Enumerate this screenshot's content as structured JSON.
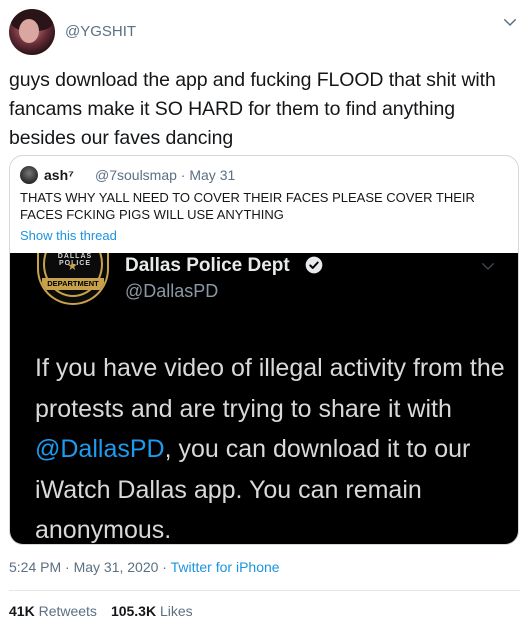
{
  "header": {
    "handle": "@YGSHIT"
  },
  "tweet": {
    "text": "guys download the app and fucking FLOOD that shit with fancams make it SO HARD for them to find anything besides our faves dancing"
  },
  "quote": {
    "name": "ash⁷",
    "handle_date": "@7soulsmap · May 31",
    "text": "THATS WHY YALL NEED TO COVER THEIR FACES PLEASE COVER THEIR FACES FCKING PIGS WILL USE ANYTHING",
    "show_thread": "Show this thread"
  },
  "embedded": {
    "badge_arc": "DALLAS POLICE",
    "badge_dept": "DEPARTMENT",
    "name": "Dallas Police Dept",
    "handle": "@DallasPD",
    "text_before": "If you have video of illegal activity from the protests and are trying to share it with ",
    "mention": "@DallasPD",
    "text_after": ", you can download it to our iWatch Dallas app. You can remain anonymous."
  },
  "meta": {
    "time_date": "5:24 PM · May 31, 2020 · ",
    "source": "Twitter for iPhone"
  },
  "stats": {
    "retweets_count": "41K",
    "retweets_label": "Retweets",
    "likes_count": "105.3K",
    "likes_label": "Likes"
  },
  "colors": {
    "link": "#1b95e0",
    "muted": "#5b7083",
    "badge_gold": "#c8a24a"
  }
}
